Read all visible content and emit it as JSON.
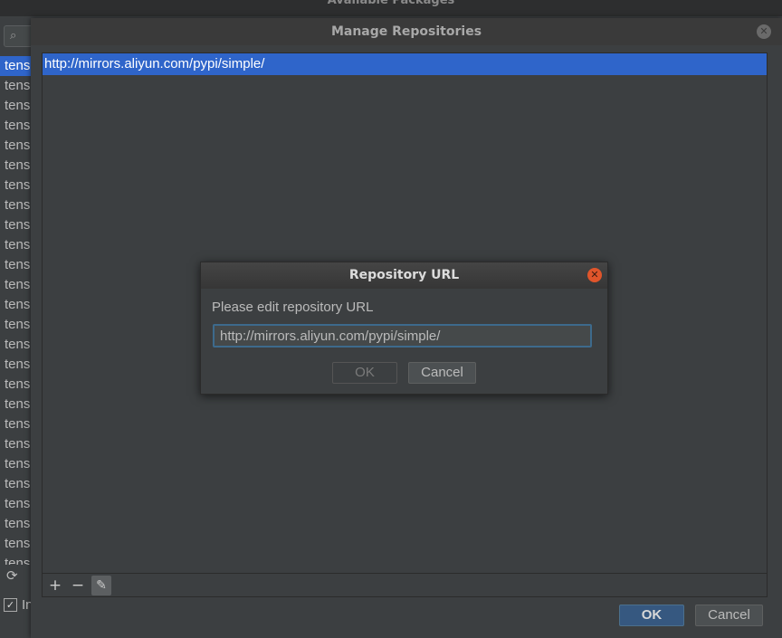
{
  "background_window": {
    "title": "Available Packages",
    "list_items": [
      "tens",
      "tens",
      "tens",
      "tens",
      "tens",
      "tens",
      "tens",
      "tens",
      "tens",
      "tens",
      "tens",
      "tens",
      "tens",
      "tens",
      "tens",
      "tens",
      "tens",
      "tens",
      "tens",
      "tens",
      "tens",
      "tens",
      "tens",
      "tens",
      "tens",
      "tens"
    ],
    "checkbox_label": "In",
    "icons": {
      "search": "search-icon",
      "refresh": "refresh-icon",
      "checkbox": "checkbox-checked-icon"
    }
  },
  "manage_dialog": {
    "title": "Manage Repositories",
    "repositories": [
      "http://mirrors.aliyun.com/pypi/simple/"
    ],
    "toolbar": {
      "add": "+",
      "remove": "−",
      "edit": "✎"
    },
    "ok_label": "OK",
    "cancel_label": "Cancel"
  },
  "url_dialog": {
    "title": "Repository URL",
    "prompt": "Please edit repository URL",
    "url_value": "http://mirrors.aliyun.com/pypi/simple/",
    "ok_label": "OK",
    "cancel_label": "Cancel"
  },
  "colors": {
    "background": "#3c3f41",
    "selection": "#2f65ca",
    "primary_button": "#365880",
    "close_button": "#e0552b"
  }
}
